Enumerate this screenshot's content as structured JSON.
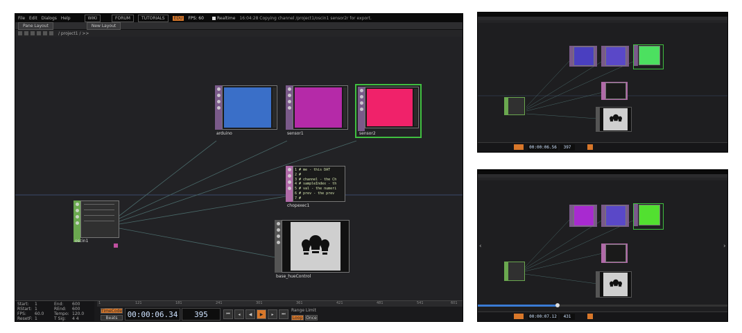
{
  "main": {
    "menu": [
      "File",
      "Edit",
      "Dialogs",
      "Help"
    ],
    "menu_pills": [
      "WIKI",
      "FORUM",
      "TUTORIALS"
    ],
    "menu_badge": "EDU",
    "fps_label": "FPS:",
    "fps_value": "60",
    "realtime": "Realtime",
    "status": "16:04:28 Copying channel /project1/oscin1 sensor2r for export.",
    "tabs": [
      "Pane Layout",
      "New Layout"
    ],
    "path": "/ project1 / >>",
    "nodes": {
      "arduino": "arduino",
      "sensor1": "sensor1",
      "sensor2": "sensor2",
      "chopexec": "chopexec1",
      "oscin": "oscin1",
      "base": "base_hueControl"
    },
    "code_lines": [
      "1 # me - this DAT",
      "2 #",
      "3 # channel - the Ch",
      "4 # sampleIndex - th",
      "5 # val - the numeri",
      "6 # prev - the prev",
      "7 #"
    ],
    "timeline": {
      "start_label": "Start:",
      "start": "1",
      "end_label": "End:",
      "end": "600",
      "rstart_label": "RStart:",
      "rstart": "1",
      "rend_label": "REnd:",
      "rend": "600",
      "fps_label": "FPS:",
      "fps": "60.0",
      "tempo_label": "Tempo:",
      "tempo": "120.0",
      "resetf_label": "ResetF:",
      "resetf": "1",
      "tsig_label": "T Sig:",
      "tsig": "4 4",
      "ruler": [
        "1",
        "121",
        "181",
        "241",
        "301",
        "361",
        "421",
        "481",
        "541",
        "601"
      ],
      "timecode": "TimeCode",
      "beats": "Beats",
      "clock": "00:00:06.34",
      "frame": "395",
      "range_limit": "Range Limit",
      "loop": "Loop",
      "once": "Once"
    }
  },
  "top_right": {
    "clock": "00:00:06.56",
    "frame": "397"
  },
  "bottom_right": {
    "clock": "00:00:07.12",
    "frame": "431"
  },
  "colors": {
    "arduino": "#3a6fc8",
    "sensor1": "#b52aa8",
    "sensor2": "#f0226a",
    "tr_a": "#4a3fc0",
    "tr_b": "#5a48c8",
    "tr_c": "#4ce060",
    "br_a": "#a82ad0",
    "br_b": "#5a48c8",
    "br_c": "#52e030",
    "chop_strip": "#7a5a8a",
    "dat_strip": "#b06aa8",
    "osc_strip": "#6aa84f",
    "comp_strip": "#555555",
    "accent": "#d8772a",
    "selected": "#40c040"
  }
}
